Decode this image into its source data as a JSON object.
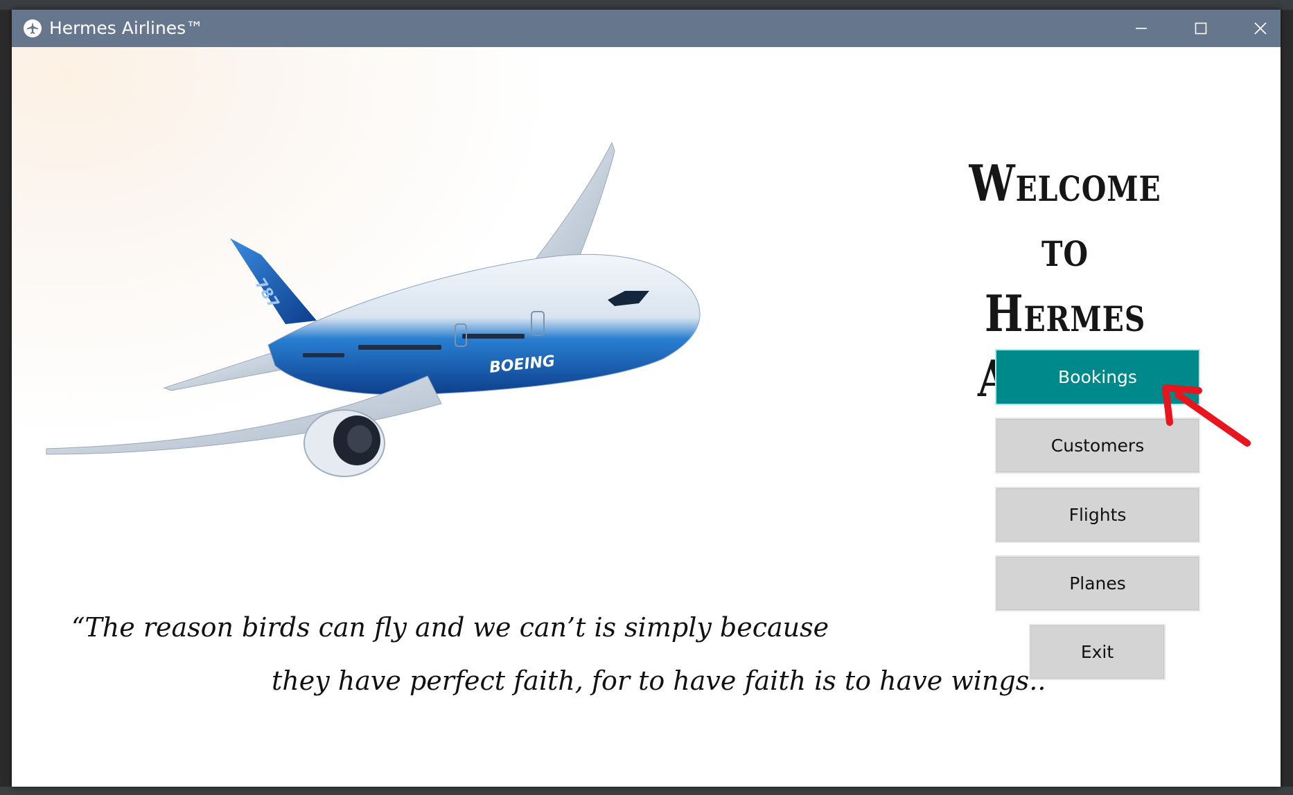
{
  "window": {
    "title": "Hermes Airlines™"
  },
  "welcome": {
    "line1": "Welcome",
    "line2": "to",
    "line3": "Hermes Airlines"
  },
  "quote": {
    "line1": "“The reason birds can fly and we can’t is simply because",
    "line2": "they have perfect faith, for to have faith is to have wings..”"
  },
  "buttons": {
    "bookings": "Bookings",
    "customers": "Customers",
    "flights": "Flights",
    "planes": "Planes",
    "exit": "Exit"
  },
  "plane": {
    "livery_text": "BOEING",
    "tail_text": "787"
  },
  "colors": {
    "titlebar": "#66768c",
    "accent": "#00898a",
    "button_gray": "#d4d4d4",
    "annotation_arrow": "#e8141e"
  }
}
